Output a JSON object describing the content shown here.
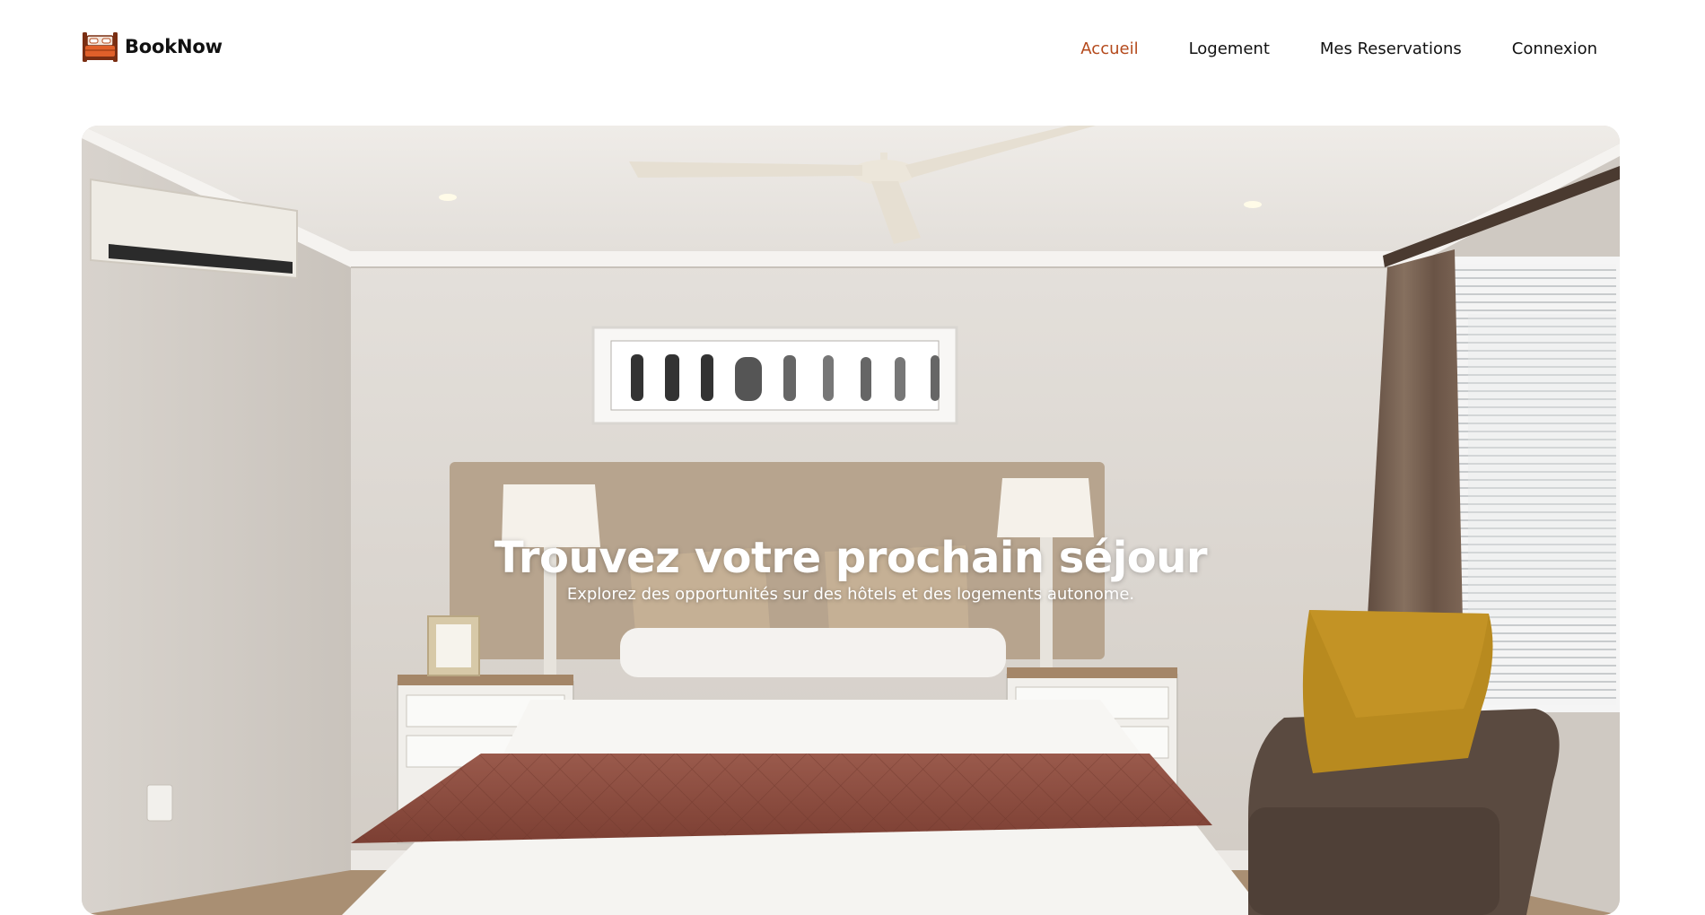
{
  "brand": {
    "name": "BookNow",
    "logo_icon": "bed-icon",
    "accent_color": "#b4491b"
  },
  "nav": {
    "items": [
      {
        "label": "Accueil",
        "active": true
      },
      {
        "label": "Logement",
        "active": false
      },
      {
        "label": "Mes Reservations",
        "active": false
      },
      {
        "label": "Connexion",
        "active": false
      }
    ]
  },
  "hero": {
    "title": "Trouvez votre prochain séjour",
    "subtitle": "Explorez des opportunités sur des hôtels et des logements autonome.",
    "image": "hotel-bedroom-photo"
  }
}
